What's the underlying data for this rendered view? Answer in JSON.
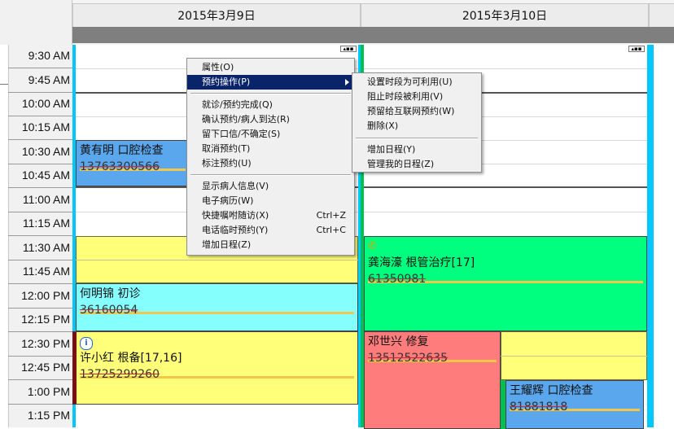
{
  "header": {
    "dates": [
      "2015年3月9日",
      "2015年3月10日"
    ]
  },
  "times": [
    "9:30 AM",
    "9:45 AM",
    "10:00 AM",
    "10:15 AM",
    "10:30 AM",
    "10:45 AM",
    "11:00 AM",
    "11:15 AM",
    "11:30 AM",
    "11:45 AM",
    "12:00 PM",
    "12:15 PM",
    "12:30 PM",
    "12:45 PM",
    "1:00 PM",
    "1:15 PM"
  ],
  "appointments": {
    "a1": {
      "title": "黄有明  口腔检查",
      "phone": "13763300566",
      "color": "#5aa7ee"
    },
    "a2": {
      "title": "何明锦  初诊",
      "phone": "36160054",
      "color": "#86ffff"
    },
    "a3": {
      "title": "许小红  根备[17,16]",
      "phone": "13725299260",
      "color": "#ffff7a"
    },
    "a4": {
      "title": "龚海濠  根管治疗[17]",
      "phone": "61350981",
      "color": "#00ff7f"
    },
    "a5": {
      "title": "邓世兴  修复",
      "phone": "13512522635",
      "color": "#ff7c7c"
    },
    "a6": {
      "title": "王耀辉  口腔检查",
      "phone": "81881818",
      "color": "#5aa7ee"
    }
  },
  "context_menu": {
    "items": [
      {
        "label": "属性(O)",
        "shortcut": ""
      },
      {
        "label": "预约操作(P)",
        "shortcut": ""
      },
      {
        "label": "就诊/预约完成(Q)",
        "shortcut": ""
      },
      {
        "label": "确认预约/病人到达(R)",
        "shortcut": ""
      },
      {
        "label": "留下口信/不确定(S)",
        "shortcut": ""
      },
      {
        "label": "取消预约(T)",
        "shortcut": ""
      },
      {
        "label": "标注预约(U)",
        "shortcut": ""
      },
      {
        "label": "显示病人信息(V)",
        "shortcut": ""
      },
      {
        "label": "电子病历(W)",
        "shortcut": ""
      },
      {
        "label": "快捷嘱咐随访(X)",
        "shortcut": "Ctrl+Z"
      },
      {
        "label": "电话临时预约(Y)",
        "shortcut": "Ctrl+C"
      },
      {
        "label": "增加日程(Z)",
        "shortcut": ""
      }
    ]
  },
  "submenu": {
    "items": [
      {
        "label": "设置时段为可利用(U)"
      },
      {
        "label": "阻止时段被利用(V)"
      },
      {
        "label": "预留给互联网预约(W)"
      },
      {
        "label": "删除(X)"
      },
      {
        "label": "增加日程(Y)"
      },
      {
        "label": "管理我的日程(Z)"
      }
    ]
  }
}
